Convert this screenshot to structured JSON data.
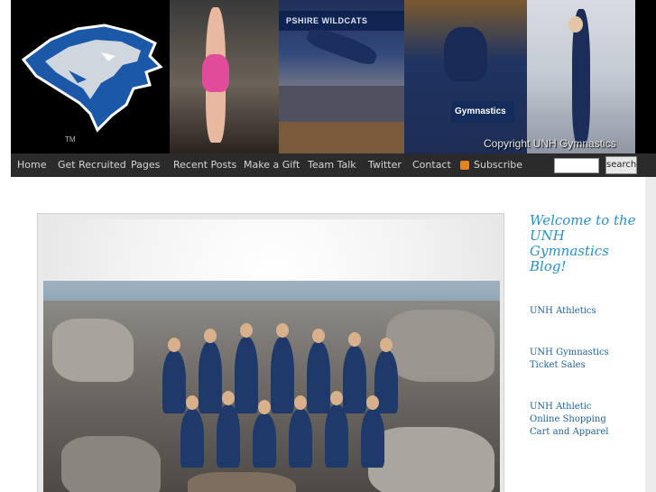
{
  "header": {
    "logo_mark": "TM",
    "copyright": "Copyright UNH Gymnastics",
    "sign_wildcats": "PSHIRE WILDCATS",
    "sign_gymnastics": "Gymnastics"
  },
  "nav": {
    "items": [
      "Home",
      "Get Recruited",
      "Pages",
      "Recent Posts",
      "Make a Gift",
      "Team Talk",
      "Twitter",
      "Contact",
      "Subscribe"
    ],
    "search_label": "search",
    "search_placeholder": ""
  },
  "sidebar": {
    "welcome": "Welcome to the UNH Gymnastics Blog!",
    "links": [
      "UNH Athletics",
      "UNH Gymnastics Ticket Sales",
      "UNH Athletic Online Shopping Cart and Apparel"
    ]
  },
  "colors": {
    "nav_bg": "#2b2b2b",
    "accent": "#2b8fc4",
    "link": "#1f5f96"
  }
}
